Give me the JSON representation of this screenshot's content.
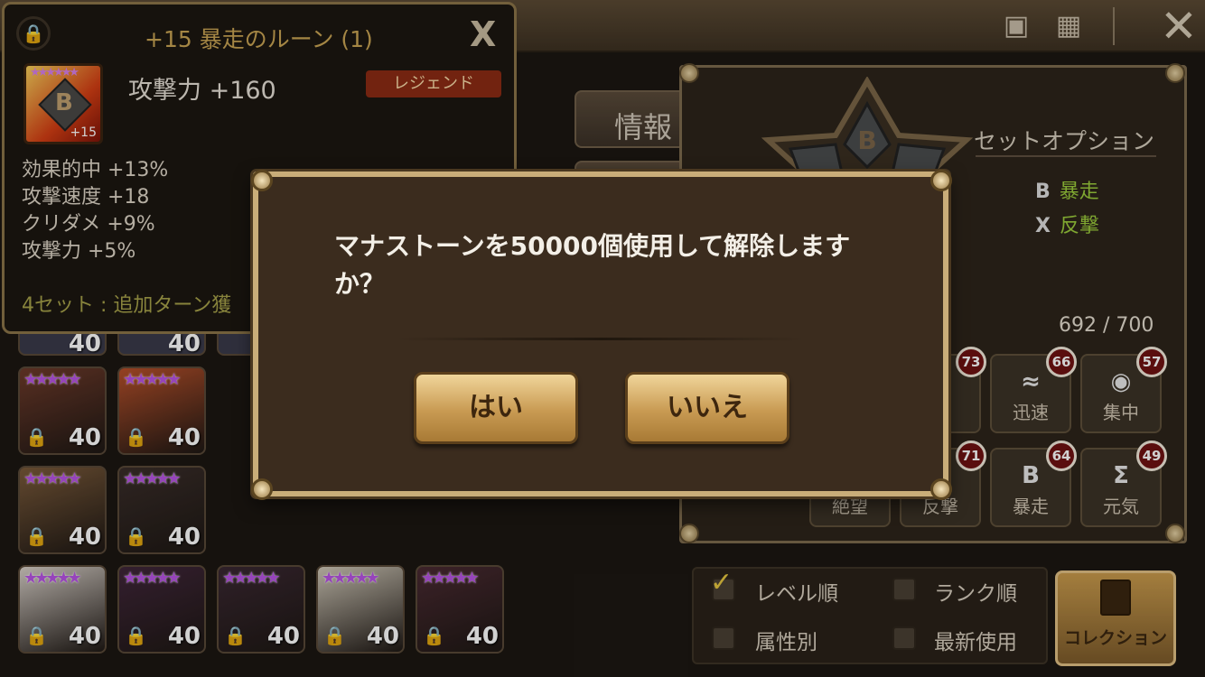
{
  "topbar": {
    "icons": [
      "window-icon",
      "grid-icon"
    ],
    "close_icon": "close-icon"
  },
  "tabs": {
    "info_label": "情報"
  },
  "set_option": {
    "title": "セットオプション",
    "items": [
      {
        "icon": "B",
        "label": "暴走"
      },
      {
        "icon": "X",
        "label": "反撃"
      }
    ]
  },
  "capacity": "692 / 700",
  "rune_filters": [
    {
      "icon": "≈",
      "label": "迅速",
      "count": "66"
    },
    {
      "icon": "◉",
      "label": "集中",
      "count": "57"
    },
    {
      "icon": "",
      "label": "絶望",
      "count": "73"
    },
    {
      "icon": "B",
      "label": "暴走",
      "count": "64"
    },
    {
      "icon": "Σ",
      "label": "元気",
      "count": "49"
    },
    {
      "icon": "",
      "label": "反撃",
      "count": "71"
    }
  ],
  "sort": {
    "level": "レベル順",
    "rank": "ランク順",
    "attribute": "属性別",
    "recent": "最新使用",
    "level_checked": true
  },
  "collection_label": "コレクション",
  "monsters": {
    "stars": "★★★★★",
    "level": "40",
    "colors": [
      "#6d3a2a",
      "#b6502a",
      "#7a5a3a",
      "#3a2e2a",
      "#d8d0c8",
      "#40263a",
      "#3a2832",
      "#d0c8b8",
      "#4a2a32",
      "#6a6058",
      "#703a3a",
      "#c08a3a",
      "#e0a040"
    ]
  },
  "rune": {
    "title": "+15 暴走のルーン (1)",
    "close": "X",
    "level": "+15",
    "stars": "★★★★★★",
    "symbol": "B",
    "main_stat": "攻撃力 +160",
    "grade": "レジェンド",
    "substats": [
      "効果的中 +13%",
      "攻撃速度 +18",
      "クリダメ +9%",
      "攻撃力 +5%"
    ],
    "set_bonus": "4セット : 追加ターン獲"
  },
  "dialog": {
    "message": "マナストーンを50000個使用して解除しますか？",
    "yes": "はい",
    "no": "いいえ"
  }
}
